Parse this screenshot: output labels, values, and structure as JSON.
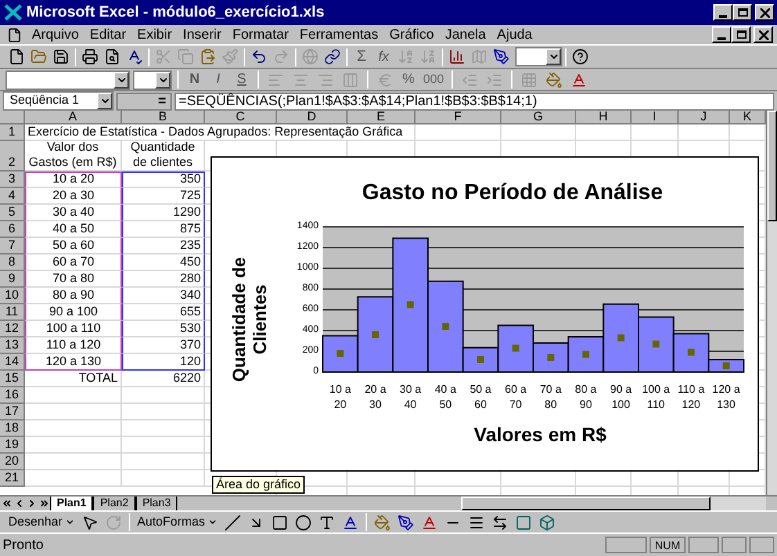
{
  "window": {
    "title": "Microsoft Excel - módulo6_exercício1.xls"
  },
  "menu": [
    "Arquivo",
    "Editar",
    "Exibir",
    "Inserir",
    "Formatar",
    "Ferramentas",
    "Gráfico",
    "Janela",
    "Ajuda"
  ],
  "standard_toolbar": {
    "autosum": "Σ",
    "function": "fx"
  },
  "format_toolbar": {
    "buttons": [
      {
        "label": "N",
        "disabled": true
      },
      {
        "label": "I",
        "disabled": true
      },
      {
        "label": "S",
        "disabled": true
      }
    ],
    "percent": "%",
    "thousands": "000"
  },
  "formula_bar": {
    "name_box": "Seqüência 1",
    "equals": "=",
    "formula": "=SEQÜÊNCIAS(;Plan1!$A$3:$A$14;Plan1!$B$3:$B$14;1)"
  },
  "columns": [
    "A",
    "B",
    "C",
    "D",
    "E",
    "F",
    "G",
    "H",
    "I",
    "J",
    "K"
  ],
  "rows": [
    {
      "number": "1",
      "cells": [
        "Exercício de Estatística - Dados Agrupados: Representação Gráfica",
        ""
      ],
      "source_range": false
    },
    {
      "number": "2",
      "cells": [
        "Valor dos Gastos (em R$)",
        "Quantidade de clientes"
      ],
      "source_range": false
    },
    {
      "number": "3",
      "cells": [
        "10 a 20",
        "350"
      ],
      "source_range": true
    },
    {
      "number": "4",
      "cells": [
        "20 a 30",
        "725"
      ],
      "source_range": true
    },
    {
      "number": "5",
      "cells": [
        "30 a 40",
        "1290"
      ],
      "source_range": true
    },
    {
      "number": "6",
      "cells": [
        "40 a 50",
        "875"
      ],
      "source_range": true
    },
    {
      "number": "7",
      "cells": [
        "50 a 60",
        "235"
      ],
      "source_range": true
    },
    {
      "number": "8",
      "cells": [
        "60 a 70",
        "450"
      ],
      "source_range": true
    },
    {
      "number": "9",
      "cells": [
        "70 a 80",
        "280"
      ],
      "source_range": true
    },
    {
      "number": "10",
      "cells": [
        "80 a 90",
        "340"
      ],
      "source_range": true
    },
    {
      "number": "11",
      "cells": [
        "90 a 100",
        "655"
      ],
      "source_range": true
    },
    {
      "number": "12",
      "cells": [
        "100 a 110",
        "530"
      ],
      "source_range": true
    },
    {
      "number": "13",
      "cells": [
        "110 a 120",
        "370"
      ],
      "source_range": true
    },
    {
      "number": "14",
      "cells": [
        "120 a 130",
        "120"
      ],
      "source_range": true
    },
    {
      "number": "15",
      "cells": [
        "TOTAL",
        "6220"
      ],
      "source_range": false
    },
    {
      "number": "16",
      "cells": [
        "",
        ""
      ],
      "source_range": false
    },
    {
      "number": "17",
      "cells": [
        "",
        ""
      ],
      "source_range": false
    },
    {
      "number": "18",
      "cells": [
        "",
        ""
      ],
      "source_range": false
    },
    {
      "number": "19",
      "cells": [
        "",
        ""
      ],
      "source_range": false
    },
    {
      "number": "20",
      "cells": [
        "",
        ""
      ],
      "source_range": false
    },
    {
      "number": "21",
      "cells": [
        "",
        ""
      ],
      "source_range": false
    }
  ],
  "chart": {
    "chart_data": {
      "type": "bar",
      "title": "Gasto no Período de Análise",
      "xlabel": "Valores em R$",
      "ylabel": "Quantidade de Clientes",
      "categories": [
        "10 a 20",
        "20 a 30",
        "30 a 40",
        "40 a 50",
        "50 a 60",
        "60 a 70",
        "70 a 80",
        "80 a 90",
        "90 a 100",
        "100 a 110",
        "110 a 120",
        "120 a 130"
      ],
      "series": [
        {
          "type": "bar",
          "color": "#8080ff",
          "values": [
            350,
            725,
            1290,
            875,
            235,
            450,
            280,
            340,
            655,
            530,
            370,
            120
          ]
        },
        {
          "type": "scatter",
          "color": "#666600",
          "values": [
            180,
            360,
            650,
            440,
            120,
            230,
            140,
            170,
            330,
            270,
            190,
            60
          ]
        }
      ],
      "grid": true,
      "ylim": [
        0,
        1400
      ],
      "yticks": [
        0,
        200,
        400,
        600,
        800,
        1000,
        1200,
        1400
      ]
    }
  },
  "tooltip": "Área do gráfico",
  "sheet_tabs": [
    {
      "label": "Plan1",
      "selected": true
    },
    {
      "label": "Plan2",
      "selected": false
    },
    {
      "label": "Plan3",
      "selected": false
    }
  ],
  "drawing_toolbar": {
    "draw": "Desenhar",
    "autoshapes": "AutoFormas"
  },
  "status_bar": {
    "message": "Pronto",
    "indicator": "NUM"
  }
}
